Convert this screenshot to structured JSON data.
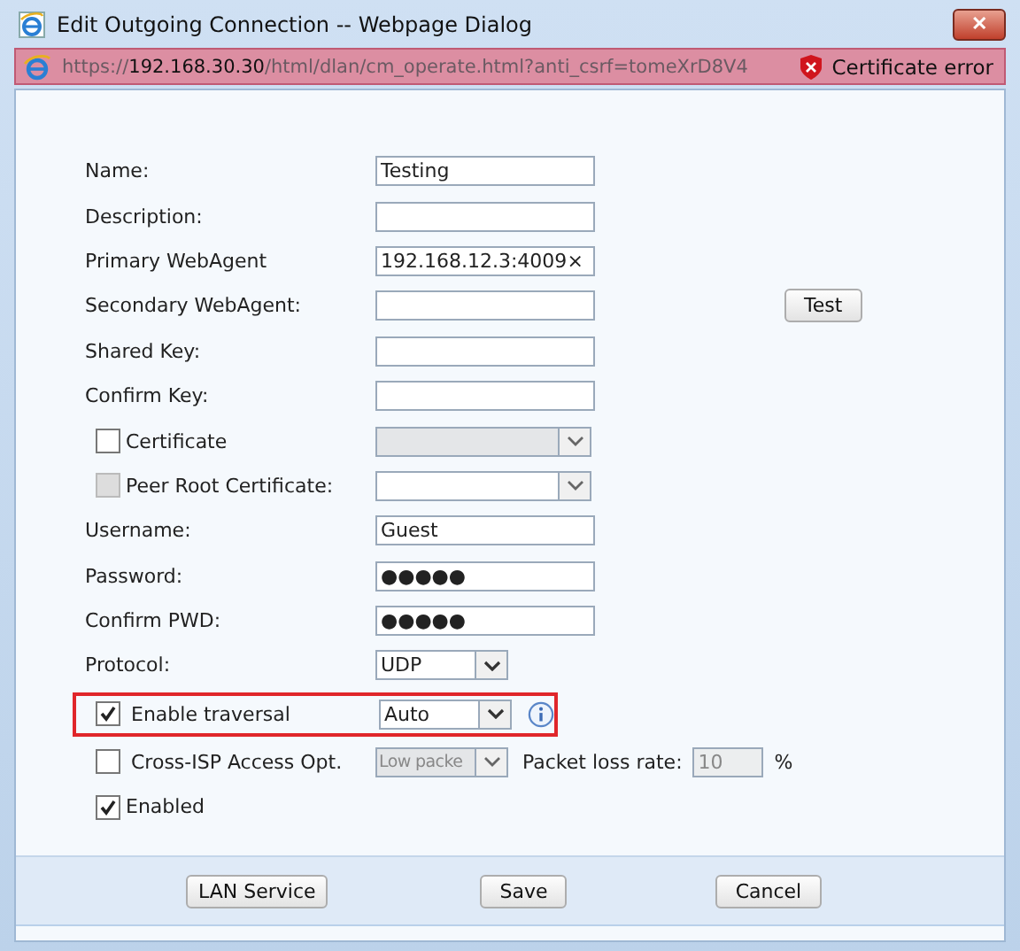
{
  "window": {
    "title": "Edit Outgoing Connection -- Webpage Dialog",
    "close": "✕"
  },
  "address_bar": {
    "url_prefix": "https://",
    "url_host": "192.168.30.30",
    "url_path": "/html/dlan/cm_operate.html?anti_csrf=tomeXrD8V4",
    "certificate_error": "Certificate error"
  },
  "rows": [
    {
      "kind": "text",
      "label": "Name:",
      "value": "Testing"
    },
    {
      "kind": "text",
      "label": "Description:"
    },
    {
      "kind": "text",
      "label": "Primary WebAgent",
      "value": "192.168.12.3:4009",
      "clear": "×"
    },
    {
      "kind": "text",
      "label": "Secondary WebAgent:",
      "button": "Test"
    },
    {
      "kind": "text",
      "label": "Shared Key:"
    },
    {
      "kind": "text",
      "label": "Confirm Key:"
    },
    {
      "kind": "check-select",
      "label": "Certificate",
      "checked": false,
      "disabled": false,
      "select_disabled": true
    },
    {
      "kind": "check-select",
      "label": "Peer Root Certificate:",
      "checked": false,
      "disabled": true,
      "select_disabled": false
    },
    {
      "kind": "text",
      "label": "Username:",
      "value": "Guest"
    },
    {
      "kind": "text",
      "label": "Password:",
      "value": "●●●●●"
    },
    {
      "kind": "text",
      "label": "Confirm PWD:",
      "value": "●●●●●"
    },
    {
      "kind": "select",
      "label": "Protocol:",
      "value": "UDP"
    },
    {
      "kind": "traversal",
      "label": "Enable traversal",
      "checked": true,
      "value": "Auto",
      "highlighted": true
    },
    {
      "kind": "cross-isp",
      "label": "Cross-ISP Access Opt.",
      "checked": false,
      "value": "Low packe",
      "select_disabled": true,
      "rate_label": "Packet loss rate:",
      "rate_value": "10",
      "unit": "%"
    },
    {
      "kind": "check",
      "label": "Enabled",
      "checked": true
    }
  ],
  "buttons": [
    "LAN Service",
    "Save",
    "Cancel"
  ]
}
